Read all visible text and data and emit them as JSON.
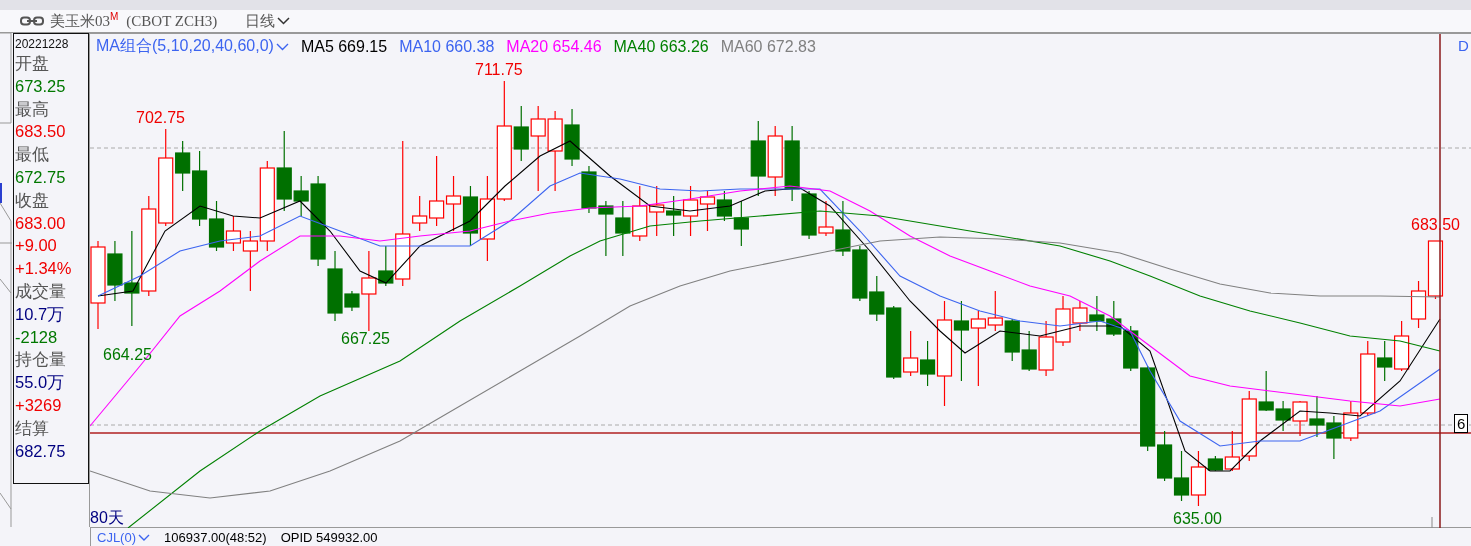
{
  "toolbar": {
    "symbol": "美玉米03",
    "superscript": "M",
    "code": "(CBOT  ZCH3)",
    "period": "日线"
  },
  "quote_panel": {
    "date": "20221228",
    "lines": [
      {
        "kind": "label",
        "text": "开盘"
      },
      {
        "kind": "value",
        "text": "673.25",
        "color": "#007800"
      },
      {
        "kind": "label",
        "text": "最高"
      },
      {
        "kind": "value",
        "text": "683.50",
        "color": "#f00000"
      },
      {
        "kind": "label",
        "text": "最低"
      },
      {
        "kind": "value",
        "text": "672.75",
        "color": "#007800"
      },
      {
        "kind": "label",
        "text": "收盘"
      },
      {
        "kind": "value",
        "text": "683.00",
        "color": "#f00000"
      },
      {
        "kind": "value",
        "text": "+9.00",
        "color": "#f00000"
      },
      {
        "kind": "value",
        "text": "+1.34%",
        "color": "#f00000"
      },
      {
        "kind": "label",
        "text": "成交量"
      },
      {
        "kind": "value",
        "text": "10.7万",
        "color": "#000080"
      },
      {
        "kind": "value",
        "text": "-2128",
        "color": "#007800"
      },
      {
        "kind": "label",
        "text": "持仓量"
      },
      {
        "kind": "value",
        "text": "55.0万",
        "color": "#000080"
      },
      {
        "kind": "value",
        "text": "+3269",
        "color": "#f00000"
      },
      {
        "kind": "label",
        "text": "结算"
      },
      {
        "kind": "value",
        "text": "682.75",
        "color": "#000080"
      }
    ]
  },
  "ma_legend": {
    "title": "MA组合(5,10,20,40,60,0)",
    "items": [
      {
        "label": "MA5 669.15",
        "color": "#000000"
      },
      {
        "label": "MA10 660.38",
        "color": "#3c64f0"
      },
      {
        "label": "MA20 654.46",
        "color": "#ff00ff"
      },
      {
        "label": "MA40 663.26",
        "color": "#008000"
      },
      {
        "label": "MA60 672.83",
        "color": "#808080"
      }
    ]
  },
  "chart": {
    "annotations": [
      {
        "text": "702.75",
        "color": "#f00000"
      },
      {
        "text": "711.75",
        "color": "#f00000"
      },
      {
        "text": "664.25",
        "color": "#007800"
      },
      {
        "text": "667.25",
        "color": "#007800"
      },
      {
        "text": "635.00",
        "color": "#007800"
      },
      {
        "text": "683.50",
        "color": "#f00000"
      }
    ],
    "span_label": "80天",
    "right_edge_texts": [
      "D",
      "6"
    ]
  },
  "indicator_bar": {
    "title": "CJL(0)",
    "values": [
      "106937.00(48:52)",
      "OPID 549932.00"
    ]
  }
}
